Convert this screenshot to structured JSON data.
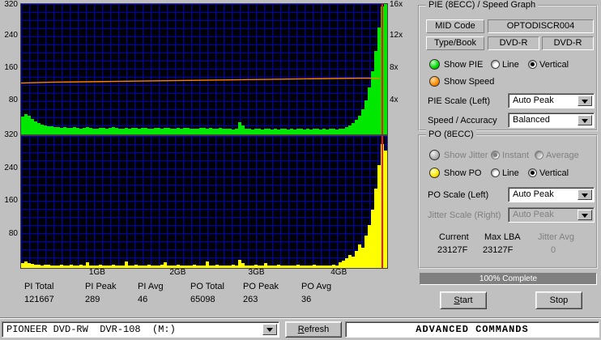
{
  "chart_data": [
    {
      "type": "area",
      "name": "PIE errors with speed overlay",
      "ylim": [
        0,
        320
      ],
      "right_ylim": [
        0,
        16
      ],
      "left_ticks": [
        "320",
        "240",
        "160",
        "80"
      ],
      "right_ticks": [
        "16x",
        "12x",
        "8x",
        "4x"
      ],
      "x_ticks": [
        "1GB",
        "2GB",
        "3GB",
        "4GB"
      ],
      "bar_color": "#00e800",
      "position_marker_pct": 98.4,
      "speed_series": {
        "color": "#ff8000",
        "points": [
          [
            0,
            6.3
          ],
          [
            8,
            6.4
          ],
          [
            25,
            6.5
          ],
          [
            50,
            6.65
          ],
          [
            75,
            6.8
          ],
          [
            92,
            6.9
          ],
          [
            98,
            6.9
          ]
        ]
      },
      "values": [
        44,
        50,
        46,
        38,
        32,
        27,
        24,
        22,
        20,
        19,
        18,
        17,
        16,
        17,
        15,
        16,
        18,
        15,
        14,
        16,
        17,
        15,
        14,
        13,
        15,
        16,
        14,
        15,
        17,
        16,
        14,
        13,
        15,
        14,
        16,
        15,
        14,
        16,
        15,
        13,
        14,
        16,
        15,
        14,
        15,
        16,
        14,
        13,
        15,
        14,
        16,
        15,
        14,
        13,
        14,
        15,
        16,
        14,
        15,
        13,
        14,
        15,
        14,
        13,
        14,
        12,
        13,
        30,
        22,
        14,
        13,
        12,
        14,
        13,
        12,
        13,
        14,
        12,
        13,
        12,
        14,
        13,
        12,
        13,
        12,
        13,
        14,
        12,
        13,
        12,
        13,
        14,
        12,
        13,
        12,
        14,
        13,
        12,
        14,
        13,
        18,
        22,
        28,
        35,
        46,
        62,
        84,
        115,
        155,
        205,
        262,
        315,
        320
      ]
    },
    {
      "type": "area",
      "name": "PO errors",
      "ylim": [
        0,
        320
      ],
      "left_ticks": [
        "320",
        "240",
        "160",
        "80"
      ],
      "bar_color": "#ffff00",
      "position_marker_pct": 98.4,
      "values": [
        12,
        15,
        11,
        9,
        8,
        7,
        6,
        7,
        8,
        6,
        5,
        6,
        7,
        5,
        6,
        8,
        6,
        5,
        7,
        6,
        14,
        6,
        5,
        6,
        7,
        5,
        6,
        5,
        7,
        6,
        5,
        6,
        16,
        6,
        5,
        7,
        6,
        5,
        6,
        7,
        5,
        6,
        5,
        7,
        13,
        6,
        5,
        6,
        7,
        5,
        6,
        5,
        6,
        7,
        5,
        6,
        5,
        15,
        6,
        5,
        7,
        6,
        5,
        6,
        5,
        7,
        6,
        20,
        12,
        6,
        5,
        6,
        7,
        5,
        6,
        12,
        5,
        6,
        5,
        7,
        6,
        5,
        6,
        5,
        6,
        7,
        5,
        6,
        5,
        6,
        7,
        5,
        6,
        5,
        6,
        5,
        7,
        6,
        14,
        18,
        24,
        31,
        28,
        42,
        56,
        50,
        78,
        104,
        142,
        192,
        250,
        300,
        285
      ]
    }
  ],
  "stats": [
    {
      "label": "PI Total",
      "value": "121667"
    },
    {
      "label": "PI Peak",
      "value": "289"
    },
    {
      "label": "PI Avg",
      "value": "46"
    },
    {
      "label": "PO Total",
      "value": "65098"
    },
    {
      "label": "PO Peak",
      "value": "263"
    },
    {
      "label": "PO Avg",
      "value": "36"
    }
  ],
  "pie_panel": {
    "title": "PIE (8ECC) / Speed Graph",
    "mid_code_label": "MID Code",
    "mid_code_value": "OPTODISCR004",
    "type_book_label": "Type/Book",
    "type_value": "DVD-R",
    "book_value": "DVD-R",
    "show_pie_label": "Show PIE",
    "line_label": "Line",
    "vertical_label": "Vertical",
    "show_speed_label": "Show Speed",
    "pie_scale_label": "PIE Scale (Left)",
    "pie_scale_value": "Auto Peak",
    "speed_accuracy_label": "Speed / Accuracy",
    "speed_accuracy_value": "Balanced"
  },
  "po_panel": {
    "title": "PO (8ECC)",
    "show_jitter_label": "Show Jitter",
    "instant_label": "Instant",
    "average_label": "Average",
    "show_po_label": "Show PO",
    "line_label": "Line",
    "vertical_label": "Vertical",
    "po_scale_label": "PO Scale (Left)",
    "po_scale_value": "Auto Peak",
    "jitter_scale_label": "Jitter Scale (Right)",
    "jitter_scale_value": "Auto Peak",
    "current_label": "Current",
    "current_value": "23127F",
    "max_lba_label": "Max LBA",
    "max_lba_value": "23127F",
    "jitter_avg_label": "Jitter Avg",
    "jitter_avg_value": "0"
  },
  "progress": {
    "text": "100% Complete",
    "percent": 100
  },
  "buttons": {
    "start": "Start",
    "stop": "Stop",
    "refresh": "Refresh"
  },
  "bottom_bar": {
    "drive_value": "PIONEER DVD-RW  DVR-108  (M:)",
    "advanced_commands": "ADVANCED COMMANDS"
  }
}
